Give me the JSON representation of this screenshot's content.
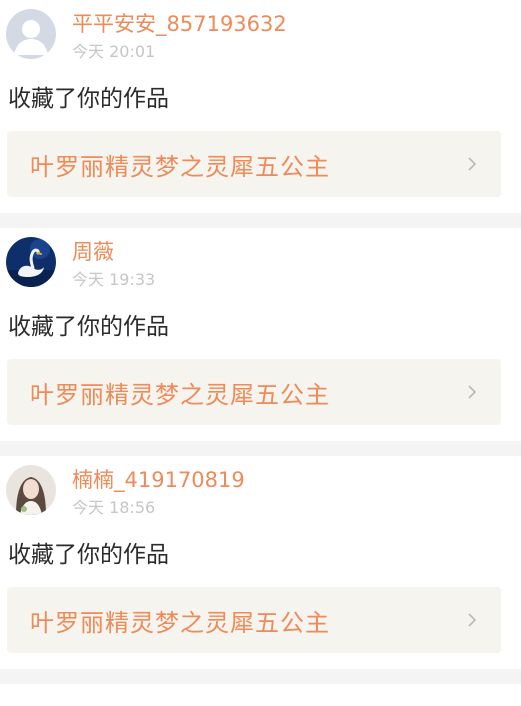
{
  "notifications": [
    {
      "username": "平平安安_857193632",
      "time": "今天 20:01",
      "action": "收藏了你的作品",
      "work_title": "叶罗丽精灵梦之灵犀五公主",
      "avatar": "default-avatar-icon"
    },
    {
      "username": "周薇",
      "time": "今天 19:33",
      "action": "收藏了你的作品",
      "work_title": "叶罗丽精灵梦之灵犀五公主",
      "avatar": "swan-avatar"
    },
    {
      "username": "楠楠_419170819",
      "time": "今天 18:56",
      "action": "收藏了你的作品",
      "work_title": "叶罗丽精灵梦之灵犀五公主",
      "avatar": "girl-photo-avatar"
    }
  ],
  "colors": {
    "accent": "#ef8a59",
    "timestamp": "#c6c6c6",
    "link_background": "#f5f4ee",
    "separator": "#f4f4f4"
  }
}
